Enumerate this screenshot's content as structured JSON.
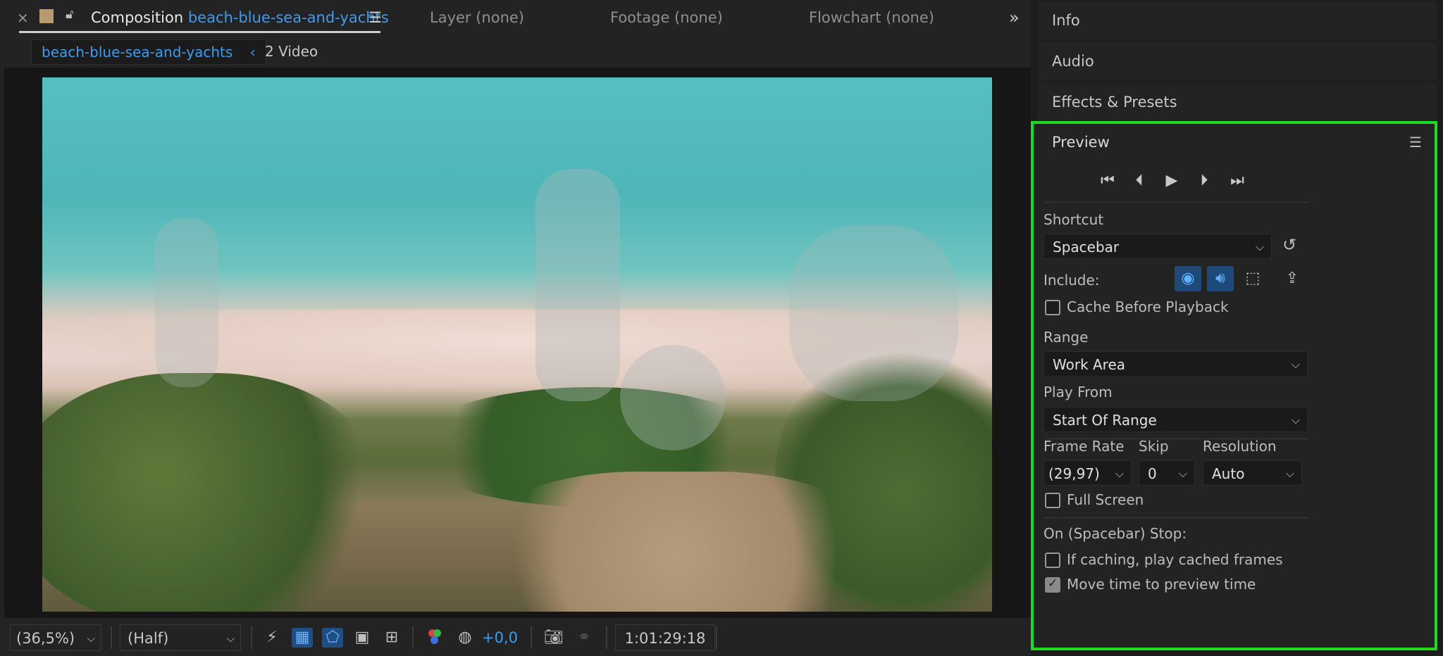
{
  "comp_tabs": {
    "close_glyph": "×",
    "active_prefix": "Composition",
    "active_name": "beach-blue-sea-and-yachts",
    "menu_glyph": "☰",
    "layer": "Layer (none)",
    "footage": "Footage (none)",
    "flowchart": "Flowchart (none)",
    "overflow_glyph": "»"
  },
  "breadcrumb": {
    "current": "beach-blue-sea-and-yachts",
    "back_glyph": "‹",
    "next": "2 Video"
  },
  "bottom_bar": {
    "zoom": "(36,5%)",
    "resolution": "(Half)",
    "exposure": "+0,0",
    "timecode": "1:01:29:18"
  },
  "panels": {
    "info": "Info",
    "audio": "Audio",
    "effects": "Effects & Presets"
  },
  "preview": {
    "title": "Preview",
    "menu_glyph": "☰",
    "shortcut_label": "Shortcut",
    "shortcut_value": "Spacebar",
    "include_label": "Include:",
    "cache_label": "Cache Before Playback",
    "range_label": "Range",
    "range_value": "Work Area",
    "play_from_label": "Play From",
    "play_from_value": "Start Of Range",
    "frame_rate_label": "Frame Rate",
    "frame_rate_value": "(29,97)",
    "skip_label": "Skip",
    "skip_value": "0",
    "resolution_label": "Resolution",
    "resolution_value": "Auto",
    "full_screen_label": "Full Screen",
    "on_stop_label": "On (Spacebar) Stop:",
    "if_caching_label": "If caching, play cached frames",
    "move_time_label": "Move time to preview time"
  },
  "colors": {
    "accent_blue": "#3b9cf3",
    "highlight_green": "#1ddc1d"
  }
}
